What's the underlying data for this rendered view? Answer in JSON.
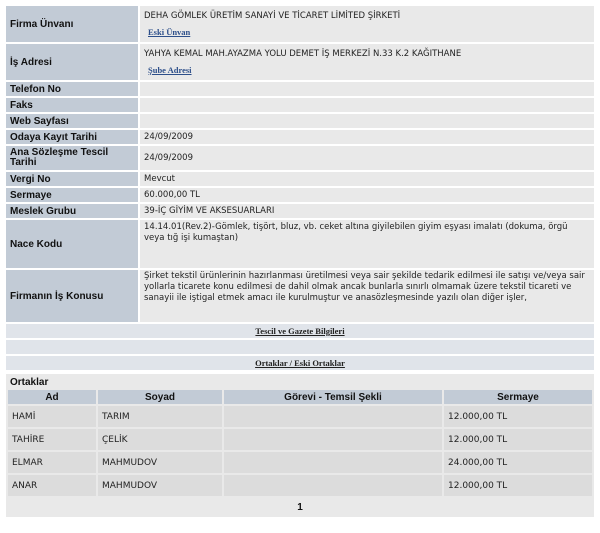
{
  "firma": {
    "unvan_label": "Firma Ünvanı",
    "unvan": "DEHA GÖMLEK ÜRETİM SANAYİ VE TİCARET LİMİTED ŞİRKETİ",
    "eski_unvan_link": "Eski Ünvan",
    "adres_label": "İş Adresi",
    "adres": "YAHYA KEMAL MAH.AYAZMA YOLU DEMET İŞ MERKEZİ N.33 K.2 KAĞITHANE",
    "sube_adresi_link": "Şube Adresi",
    "telefon_label": "Telefon No",
    "telefon": "",
    "faks_label": "Faks",
    "faks": "",
    "web_label": "Web Sayfası",
    "web": "",
    "odaya_kayit_label": "Odaya Kayıt Tarihi",
    "odaya_kayit": "24/09/2009",
    "ana_sozlesme_label": "Ana Sözleşme Tescil Tarihi",
    "ana_sozlesme": "24/09/2009",
    "vergi_label": "Vergi No",
    "vergi": "Mevcut",
    "sermaye_label": "Sermaye",
    "sermaye": "60.000,00 TL",
    "meslek_label": "Meslek Grubu",
    "meslek": "39-İÇ GİYİM VE AKSESUARLARI",
    "nace_label": "Nace Kodu",
    "nace": "14.14.01(Rev.2)-Gömlek, tişört, bluz, vb. ceket altına giyilebilen giyim eşyası imalatı (dokuma, örgü veya tığ işi kumaştan)",
    "konu_label": "Firmanın İş Konusu",
    "konu": "Şirket tekstil ürünlerinin hazırlanması üretilmesi veya sair şekilde tedarik edilmesi ile satışı ve/veya sair yollarla ticarete konu edilmesi de dahil olmak ancak bunlarla sınırlı olmamak üzere tekstil ticareti ve sanayii ile iştigal etmek amacı ile kurulmuştur ve anasözleşmesinde yazılı olan diğer işler,"
  },
  "links": {
    "tescil": "Tescil ve Gazete Bilgileri",
    "ortaklar": "Ortaklar / Eski Ortaklar"
  },
  "ortaklar": {
    "title": "Ortaklar",
    "headers": [
      "Ad",
      "Soyad",
      "Görevi - Temsil Şekli",
      "Sermaye"
    ],
    "rows": [
      [
        "HAMİ",
        "TARIM",
        "",
        "12.000,00 TL"
      ],
      [
        "TAHİRE",
        "ÇELİK",
        "",
        "12.000,00 TL"
      ],
      [
        "ELMAR",
        "MAHMUDOV",
        "",
        "24.000,00 TL"
      ],
      [
        "ANAR",
        "MAHMUDOV",
        "",
        "12.000,00 TL"
      ]
    ],
    "page": "1"
  }
}
